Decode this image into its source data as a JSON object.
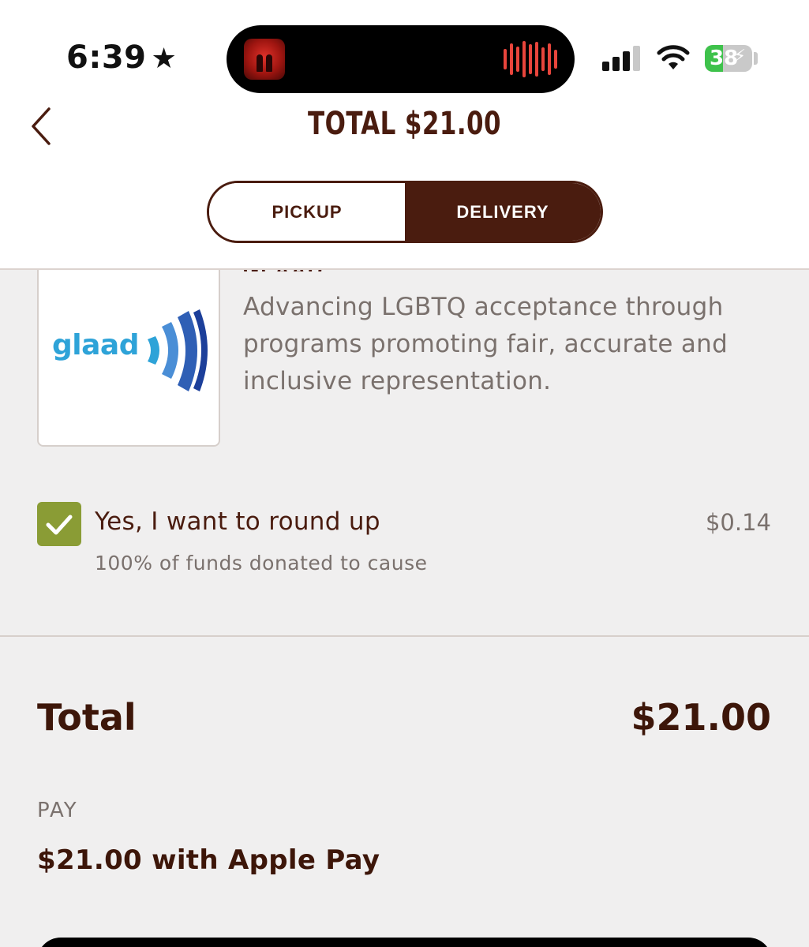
{
  "status_bar": {
    "time": "6:39",
    "location_icon": "star-icon",
    "battery_percent": "38",
    "signal_bars": 3,
    "battery_color": "#3ec24b"
  },
  "header": {
    "back_icon": "chevron-left-icon",
    "title": "TOTAL $21.00",
    "tabs": [
      {
        "label": "PICKUP",
        "selected": false
      },
      {
        "label": "DELIVERY",
        "selected": true
      }
    ]
  },
  "charity": {
    "name": "GLAAD",
    "logo_text": "glaad",
    "description": "Advancing LGBTQ acceptance through programs promoting fair, accurate and inclusive representation."
  },
  "round_up": {
    "checked": true,
    "label": "Yes, I want to round up",
    "sublabel": "100% of funds donated to cause",
    "amount": "$0.14",
    "checkbox_color": "#8a9c35"
  },
  "summary": {
    "total_label": "Total",
    "total_amount": "$21.00",
    "pay_heading": "PAY",
    "pay_method": "$21.00 with Apple Pay"
  },
  "colors": {
    "brand_brown": "#4a1c0f",
    "background": "#f0efef"
  }
}
